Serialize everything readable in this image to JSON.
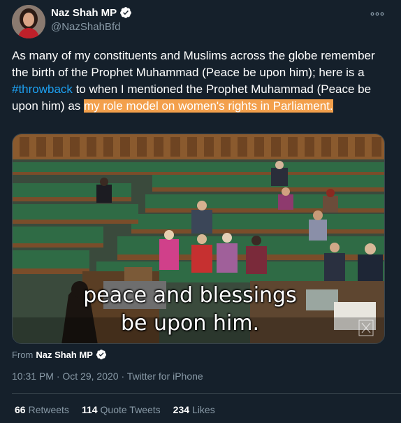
{
  "author": {
    "display_name": "Naz Shah MP",
    "handle": "@NazShahBfd"
  },
  "tweet": {
    "text_1": "As many of my constituents and Muslims across the globe remember the birth of the Prophet Muhammad (Peace be upon him); here is a ",
    "hashtag": "#throwback",
    "text_2": " to when I mentioned the Prophet Muhammad (Peace be upon him) as ",
    "highlighted": "my role model on women's rights in Parliament."
  },
  "media": {
    "caption_line_1": "peace and blessings",
    "caption_line_2": "be upon him."
  },
  "from": {
    "prefix": "From",
    "name": "Naz Shah MP"
  },
  "meta": {
    "time": "10:31 PM",
    "separator": "·",
    "date": "Oct 29, 2020",
    "source": "Twitter for iPhone"
  },
  "stats": {
    "retweets_count": "66",
    "retweets_label": "Retweets",
    "quote_count": "114",
    "quote_label": "Quote Tweets",
    "likes_count": "234",
    "likes_label": "Likes"
  },
  "colors": {
    "background": "#15202b",
    "link": "#1da1f2",
    "highlight": "#f3a04c",
    "secondary_text": "#8899a6",
    "verified": "#ffffff"
  }
}
